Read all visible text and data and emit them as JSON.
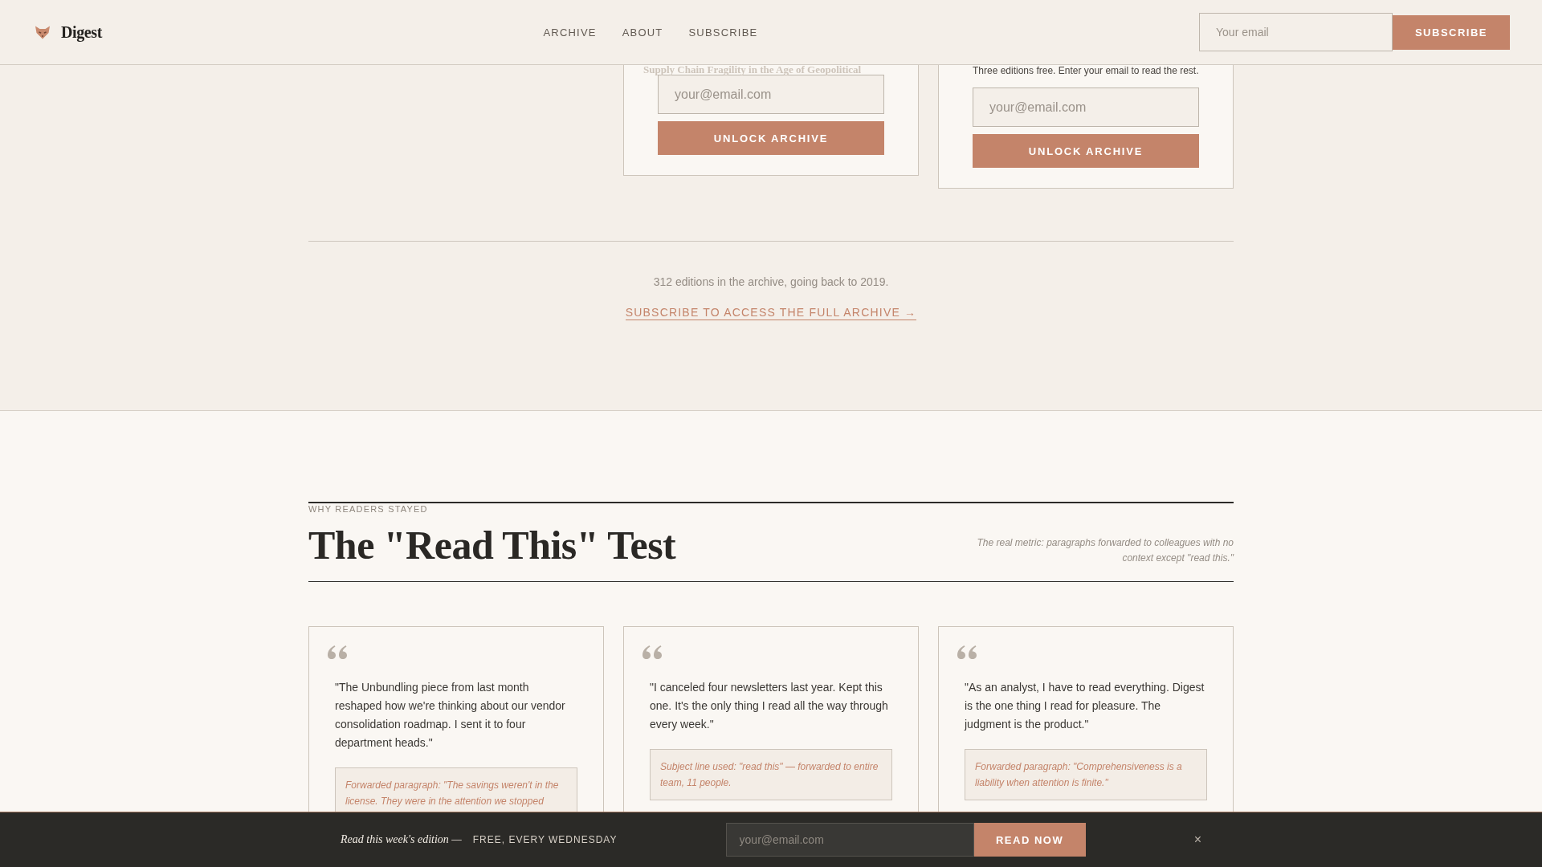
{
  "header": {
    "logo": {
      "wordmark": "Digest"
    },
    "nav": [
      {
        "label": "ARCHIVE"
      },
      {
        "label": "ABOUT"
      },
      {
        "label": "SUBSCRIBE"
      }
    ],
    "email_field": {
      "placeholder": "Your email"
    },
    "subscribe_button": "SUBSCRIBE"
  },
  "archive": {
    "locked_cards": [
      {
        "faded_title": "Supply Chain Fragility in the Age of Geopolitical",
        "email_field": {
          "placeholder": "your@email.com"
        },
        "button": "UNLOCK ARCHIVE"
      },
      {
        "gate_message": "Three editions free. Enter your email to read the rest.",
        "email_field": {
          "placeholder": "your@email.com"
        },
        "button": "UNLOCK ARCHIVE"
      }
    ],
    "count_text": "312 editions in the archive, going back to 2019.",
    "cta_link": "SUBSCRIBE TO ACCESS THE FULL ARCHIVE →"
  },
  "testimonials": {
    "eyebrow": "WHY READERS STAYED",
    "title": "The \"Read This\" Test",
    "note": "The real metric: paragraphs forwarded to colleagues with no context except \"read this.\"",
    "cards": [
      {
        "quote": "\"The Unbundling piece from last month reshaped how we're thinking about our vendor consolidation roadmap. I sent it to four department heads.\"",
        "forwarded": "Forwarded paragraph: \"The savings weren't in the license. They were in the attention we stopped"
      },
      {
        "quote": "\"I canceled four newsletters last year. Kept this one. It's the only thing I read all the way through every week.\"",
        "forwarded": "Subject line used: \"read this\" — forwarded to entire team, 11 people."
      },
      {
        "quote": "\"As an analyst, I have to read everything. Digest is the one thing I read for pleasure. The judgment is the product.\"",
        "forwarded": "Forwarded paragraph: \"Comprehensiveness is a liability when attention is finite.\""
      }
    ]
  },
  "sticky_bar": {
    "lead": "Read this week's edition —",
    "tagline": "FREE, EVERY WEDNESDAY",
    "email_field": {
      "placeholder": "your@email.com"
    },
    "button": "READ NOW",
    "close": "×"
  }
}
